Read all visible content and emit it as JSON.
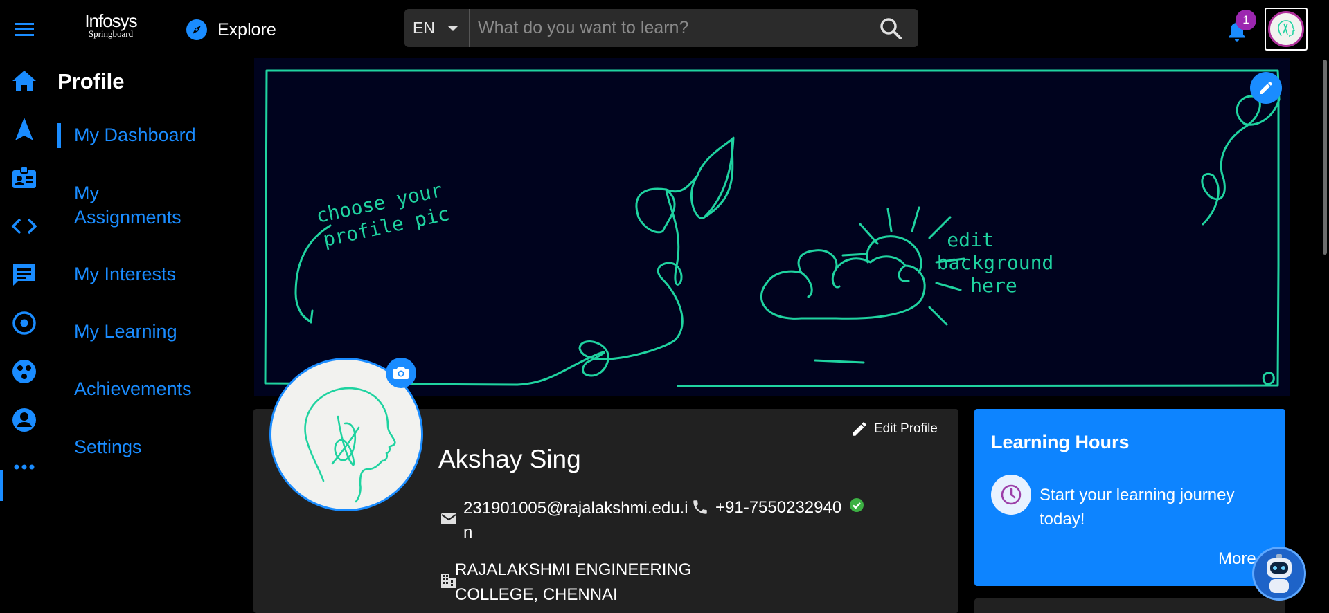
{
  "header": {
    "logo": {
      "line1": "Infosys",
      "line2": "Springboard"
    },
    "explore_label": "Explore",
    "language": "EN",
    "search_placeholder": "What do you want to learn?",
    "notification_count": "1"
  },
  "colors": {
    "accent": "#1a8cff",
    "badge": "#9c27b0",
    "banner_bg": "#00031e",
    "doodle": "#1fd3a0",
    "card_bg": "#212121",
    "learning_card": "#0d84ff"
  },
  "rail": {
    "icons": [
      "home-icon",
      "navigation-icon",
      "badge-icon",
      "code-icon",
      "chat-icon",
      "target-icon",
      "community-icon",
      "profile-icon",
      "more-icon"
    ]
  },
  "submenu": {
    "title": "Profile",
    "items": [
      {
        "label": "My Dashboard"
      },
      {
        "label": "My Assignments"
      },
      {
        "label": "My Interests"
      },
      {
        "label": "My Learning"
      },
      {
        "label": "Achievements"
      },
      {
        "label": "Settings"
      }
    ]
  },
  "banner": {
    "left_text": [
      "choose your",
      "profile pic"
    ],
    "right_text": [
      "edit",
      "background",
      "here"
    ]
  },
  "profile": {
    "edit_label": "Edit Profile",
    "name": "Akshay Sing",
    "email": "231901005@rajalakshmi.edu.in",
    "phone": "+91-7550232940",
    "organization": "RAJALAKSHMI ENGINEERING COLLEGE, CHENNAI"
  },
  "learning_hours": {
    "title": "Learning Hours",
    "message": "Start your learning journey today!",
    "more_label": "More"
  }
}
